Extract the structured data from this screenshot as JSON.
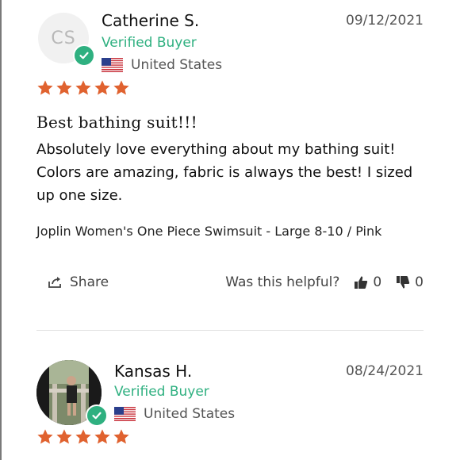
{
  "reviews": [
    {
      "initials": "CS",
      "name": "Catherine S.",
      "verified": "Verified Buyer",
      "country": "United States",
      "date": "09/12/2021",
      "rating": 5,
      "title": "Best bathing suit!!!",
      "body": "Absolutely love everything about my bathing suit! Colors are amazing, fabric is always the best! I sized up one size.",
      "product": "Joplin Women's One Piece Swimsuit - Large 8-10 / Pink",
      "share_label": "Share",
      "helpful_label": "Was this helpful?",
      "up_count": "0",
      "down_count": "0"
    },
    {
      "name": "Kansas H.",
      "verified": "Verified Buyer",
      "country": "United States",
      "date": "08/24/2021",
      "rating": 5
    }
  ],
  "colors": {
    "star": "#e0622f",
    "verified": "#2fb080",
    "divider": "#e2e2e2"
  },
  "icons": [
    "verified-check-icon",
    "us-flag-icon",
    "star-icon",
    "share-icon",
    "thumbs-up-icon",
    "thumbs-down-icon"
  ]
}
